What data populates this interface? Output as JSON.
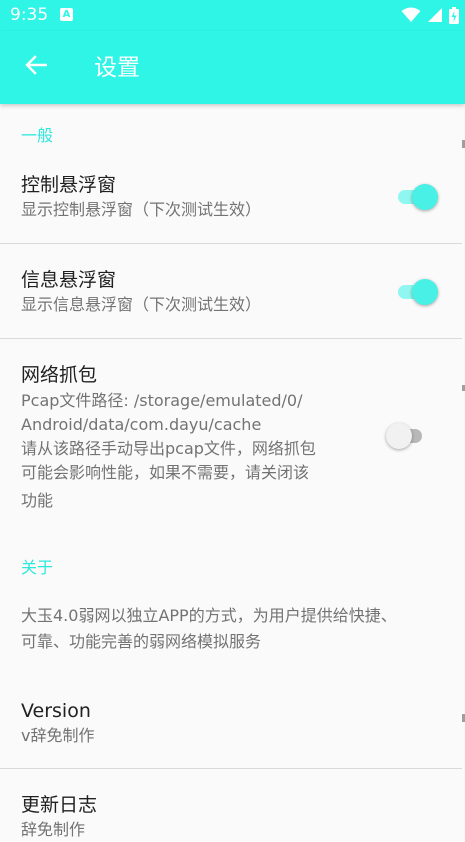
{
  "status_bar": {
    "time": "9:35",
    "notification_icon": "A",
    "icons": [
      "wifi-icon",
      "signal-icon",
      "battery-icon"
    ]
  },
  "app_bar": {
    "back_icon": "arrow-left-icon",
    "title": "设置"
  },
  "sections": [
    {
      "header": "一般",
      "items": [
        {
          "title": "控制悬浮窗",
          "summary": "显示控制悬浮窗（下次测试生效）",
          "switch_on": true
        },
        {
          "title": "信息悬浮窗",
          "summary": "显示信息悬浮窗（下次测试生效）",
          "switch_on": true
        },
        {
          "title": "网络抓包",
          "summary_lines": [
            "Pcap文件路径: /storage/emulated/0/",
            "Android/data/com.dayu/cache",
            "请从该路径手动导出pcap文件，网络抓包",
            "可能会影响性能，如果不需要，请关闭该",
            "功能"
          ],
          "switch_on": false
        }
      ]
    },
    {
      "header": "关于",
      "items": [
        {
          "summary_lines": [
            "大玉4.0弱网以独立APP的方式，为用户提供给快捷、",
            "可靠、功能完善的弱网络模拟服务"
          ]
        },
        {
          "title": "Version",
          "summary": "v辞免制作"
        },
        {
          "title": "更新日志",
          "summary": "辞免制作"
        }
      ]
    }
  ],
  "colors": {
    "accent": "#2ef5e6",
    "switch_on_thumb": "#48f0e6",
    "switch_on_track": "#8ff7ef",
    "section_header": "#2ee8dc"
  }
}
